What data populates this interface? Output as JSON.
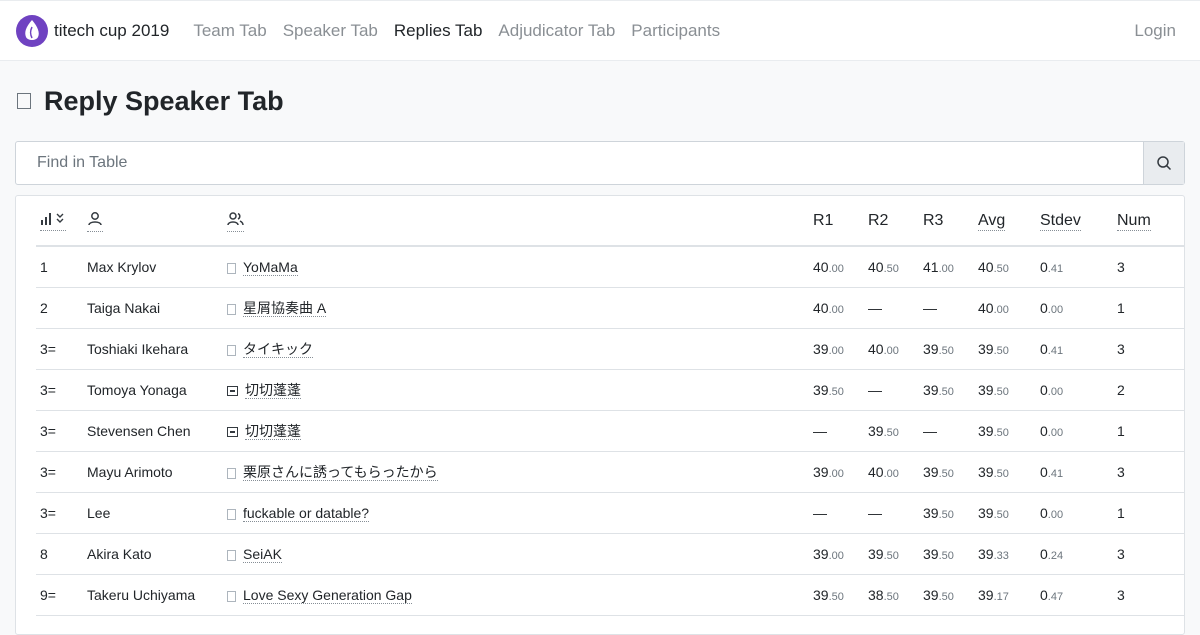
{
  "nav": {
    "brand": "titech cup 2019",
    "items": [
      {
        "label": "Team Tab",
        "active": false
      },
      {
        "label": "Speaker Tab",
        "active": false
      },
      {
        "label": "Replies Tab",
        "active": true
      },
      {
        "label": "Adjudicator Tab",
        "active": false
      },
      {
        "label": "Participants",
        "active": false
      }
    ],
    "login": "Login"
  },
  "page": {
    "title": "Reply Speaker Tab"
  },
  "search": {
    "placeholder": "Find in Table"
  },
  "table": {
    "columns": [
      "",
      "",
      "",
      "R1",
      "R2",
      "R3",
      "Avg",
      "Stdev",
      "Num"
    ],
    "rows": [
      {
        "rank": "1",
        "name": "Max Krylov",
        "team": "YoMaMa",
        "flag": false,
        "r1": [
          "40",
          ".00"
        ],
        "r2": [
          "40",
          ".50"
        ],
        "r3": [
          "41",
          ".00"
        ],
        "avg": [
          "40",
          ".50"
        ],
        "stdev": [
          "0",
          ".41"
        ],
        "num": "3"
      },
      {
        "rank": "2",
        "name": "Taiga Nakai",
        "team": "星屑協奏曲 A",
        "flag": false,
        "r1": [
          "40",
          ".00"
        ],
        "r2": [
          "—",
          ""
        ],
        "r3": [
          "—",
          ""
        ],
        "avg": [
          "40",
          ".00"
        ],
        "stdev": [
          "0",
          ".00"
        ],
        "num": "1"
      },
      {
        "rank": "3=",
        "name": "Toshiaki Ikehara",
        "team": "タイキック",
        "flag": false,
        "r1": [
          "39",
          ".00"
        ],
        "r2": [
          "40",
          ".00"
        ],
        "r3": [
          "39",
          ".50"
        ],
        "avg": [
          "39",
          ".50"
        ],
        "stdev": [
          "0",
          ".41"
        ],
        "num": "3"
      },
      {
        "rank": "3=",
        "name": "Tomoya Yonaga",
        "team": "切切蓬蓬",
        "flag": true,
        "r1": [
          "39",
          ".50"
        ],
        "r2": [
          "—",
          ""
        ],
        "r3": [
          "39",
          ".50"
        ],
        "avg": [
          "39",
          ".50"
        ],
        "stdev": [
          "0",
          ".00"
        ],
        "num": "2"
      },
      {
        "rank": "3=",
        "name": "Stevensen Chen",
        "team": "切切蓬蓬",
        "flag": true,
        "r1": [
          "—",
          ""
        ],
        "r2": [
          "39",
          ".50"
        ],
        "r3": [
          "—",
          ""
        ],
        "avg": [
          "39",
          ".50"
        ],
        "stdev": [
          "0",
          ".00"
        ],
        "num": "1"
      },
      {
        "rank": "3=",
        "name": "Mayu Arimoto",
        "team": "栗原さんに誘ってもらったから",
        "flag": false,
        "r1": [
          "39",
          ".00"
        ],
        "r2": [
          "40",
          ".00"
        ],
        "r3": [
          "39",
          ".50"
        ],
        "avg": [
          "39",
          ".50"
        ],
        "stdev": [
          "0",
          ".41"
        ],
        "num": "3"
      },
      {
        "rank": "3=",
        "name": "Lee",
        "team": "fuckable or datable?",
        "flag": false,
        "r1": [
          "—",
          ""
        ],
        "r2": [
          "—",
          ""
        ],
        "r3": [
          "39",
          ".50"
        ],
        "avg": [
          "39",
          ".50"
        ],
        "stdev": [
          "0",
          ".00"
        ],
        "num": "1"
      },
      {
        "rank": "8",
        "name": "Akira Kato",
        "team": "SeiAK",
        "flag": false,
        "r1": [
          "39",
          ".00"
        ],
        "r2": [
          "39",
          ".50"
        ],
        "r3": [
          "39",
          ".50"
        ],
        "avg": [
          "39",
          ".33"
        ],
        "stdev": [
          "0",
          ".24"
        ],
        "num": "3"
      },
      {
        "rank": "9=",
        "name": "Takeru Uchiyama",
        "team": "Love Sexy Generation Gap",
        "flag": false,
        "r1": [
          "39",
          ".50"
        ],
        "r2": [
          "38",
          ".50"
        ],
        "r3": [
          "39",
          ".50"
        ],
        "avg": [
          "39",
          ".17"
        ],
        "stdev": [
          "0",
          ".47"
        ],
        "num": "3"
      }
    ]
  }
}
